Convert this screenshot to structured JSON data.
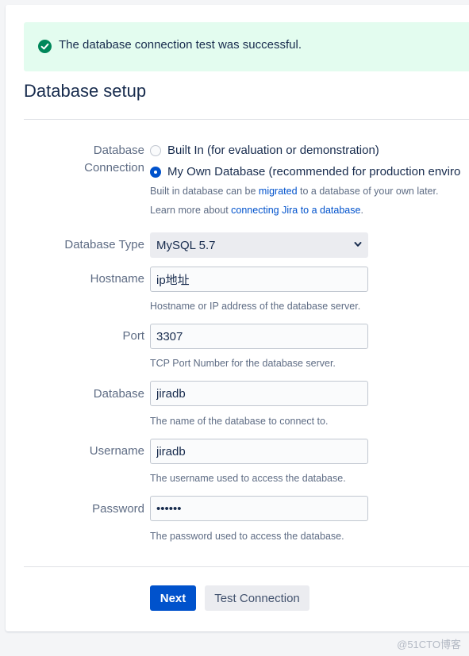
{
  "banner": {
    "message": "The database connection test was successful.",
    "icon": "check-circle-icon",
    "color": "#00875a"
  },
  "page": {
    "title": "Database setup"
  },
  "connection": {
    "label_line1": "Database",
    "label_line2": "Connection",
    "options": [
      {
        "label": "Built In (for evaluation or demonstration)",
        "checked": false
      },
      {
        "label": "My Own Database (recommended for production enviro",
        "checked": true
      }
    ],
    "note1_prefix": "Built in database can be ",
    "note1_link": "migrated",
    "note1_suffix": " to a database of your own later.",
    "note2_prefix": "Learn more about ",
    "note2_link": "connecting Jira to a database",
    "note2_suffix": "."
  },
  "fields": {
    "db_type": {
      "label": "Database Type",
      "value": "MySQL 5.7"
    },
    "hostname": {
      "label": "Hostname",
      "value": "ip地址",
      "help": "Hostname or IP address of the database server."
    },
    "port": {
      "label": "Port",
      "value": "3307",
      "help": "TCP Port Number for the database server."
    },
    "database": {
      "label": "Database",
      "value": "jiradb",
      "help": "The name of the database to connect to."
    },
    "username": {
      "label": "Username",
      "value": "jiradb",
      "help": "The username used to access the database."
    },
    "password": {
      "label": "Password",
      "value": "••••••",
      "help": "The password used to access the database."
    }
  },
  "buttons": {
    "next": "Next",
    "test": "Test Connection"
  },
  "colors": {
    "primary": "#0052cc",
    "success_bg": "#e3fcef"
  },
  "watermark": "@51CTO博客"
}
